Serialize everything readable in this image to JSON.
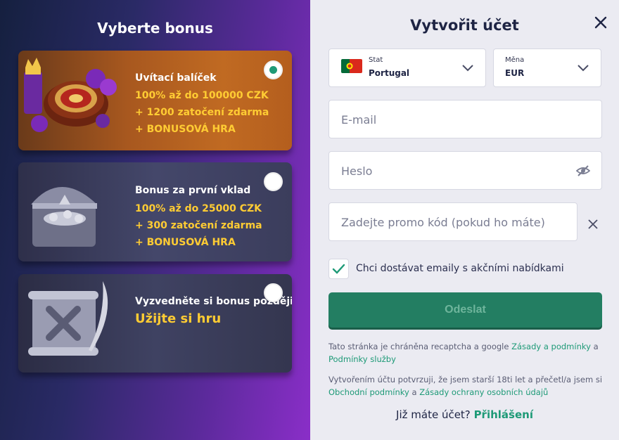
{
  "bonus_panel": {
    "title": "Vyberte bonus",
    "cards": [
      {
        "name": "Uvítací balíček",
        "lines": [
          "100% až do 100000 CZK",
          "+ 1200 zatočení zdarma",
          "+ BONUSOVÁ HRA"
        ],
        "selected": true
      },
      {
        "name": "Bonus za první vklad",
        "lines": [
          "100% až do 25000 CZK",
          "+ 300 zatočení zdarma",
          "+ BONUSOVÁ HRA"
        ],
        "selected": false
      },
      {
        "name": "Vyzvedněte si bonus později",
        "lines": [
          "Užijte si hru"
        ],
        "selected": false
      }
    ]
  },
  "form": {
    "title": "Vytvořit účet",
    "country_label": "Stat",
    "country_value": "Portugal",
    "currency_label": "Měna",
    "currency_value": "EUR",
    "email_placeholder": "E-mail",
    "password_placeholder": "Heslo",
    "promo_placeholder": "Zadejte promo kód (pokud ho máte)",
    "newsletter_label": "Chci dostávat emaily s akčními nabídkami",
    "newsletter_checked": true,
    "submit_label": "Odeslat",
    "recaptcha_text": "Tato stránka je chráněna recaptcha a google",
    "recaptcha_link1": "Zásady a podmínky",
    "recaptcha_and": "a",
    "recaptcha_link2": "Podmínky služby",
    "consent_text": "Vytvořením účtu potvrzuji, že jsem starší 18ti let a přečetl/a jsem si",
    "consent_link1": "Obchodní podmínky",
    "consent_and": "a",
    "consent_link2": "Zásady ochrany osobních údajů",
    "have_account": "Již máte účet?",
    "login_link": "Přihlášení"
  },
  "colors": {
    "accent": "#1e9a77",
    "bonus_highlight": "#ffcc33",
    "submit_bg": "#237e62"
  },
  "icons": [
    "close-icon",
    "portugal-flag-icon",
    "chevron-down-icon",
    "eye-off-icon",
    "clear-icon",
    "checkmark-icon"
  ]
}
